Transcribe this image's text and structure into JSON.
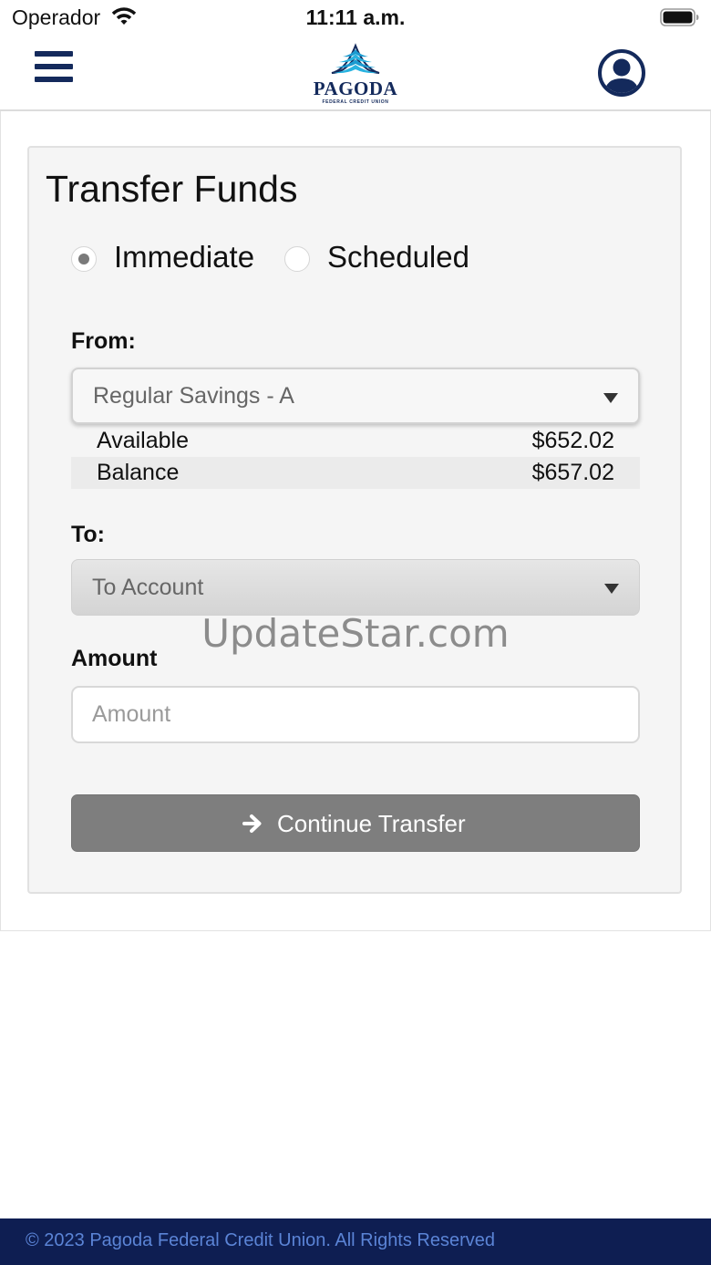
{
  "status_bar": {
    "carrier": "Operador",
    "time": "11:11 a.m.",
    "icons": [
      "wifi-icon",
      "battery-icon"
    ]
  },
  "header": {
    "logo_name": "PAGODA",
    "logo_tagline": "FEDERAL CREDIT UNION",
    "menu_icon": "hamburger-menu-icon",
    "profile_icon": "user-profile-icon",
    "brand_color": "#142a5c"
  },
  "transfer": {
    "title": "Transfer Funds",
    "timing_options": [
      {
        "label": "Immediate",
        "selected": true
      },
      {
        "label": "Scheduled",
        "selected": false
      }
    ],
    "from_label": "From:",
    "from_selected": "Regular Savings - A",
    "available_label": "Available",
    "available_value": "$652.02",
    "balance_label": "Balance",
    "balance_value": "$657.02",
    "to_label": "To:",
    "to_placeholder": "To Account",
    "amount_label": "Amount",
    "amount_placeholder": "Amount",
    "amount_value": "",
    "continue_label": "Continue Transfer",
    "continue_icon": "arrow-right-icon",
    "button_color": "#7e7e7e"
  },
  "watermark": "UpdateStar.com",
  "footer": {
    "text": "© 2023 Pagoda Federal Credit Union. All Rights Reserved",
    "background": "#0e1e52",
    "text_color": "#5b84d6"
  }
}
